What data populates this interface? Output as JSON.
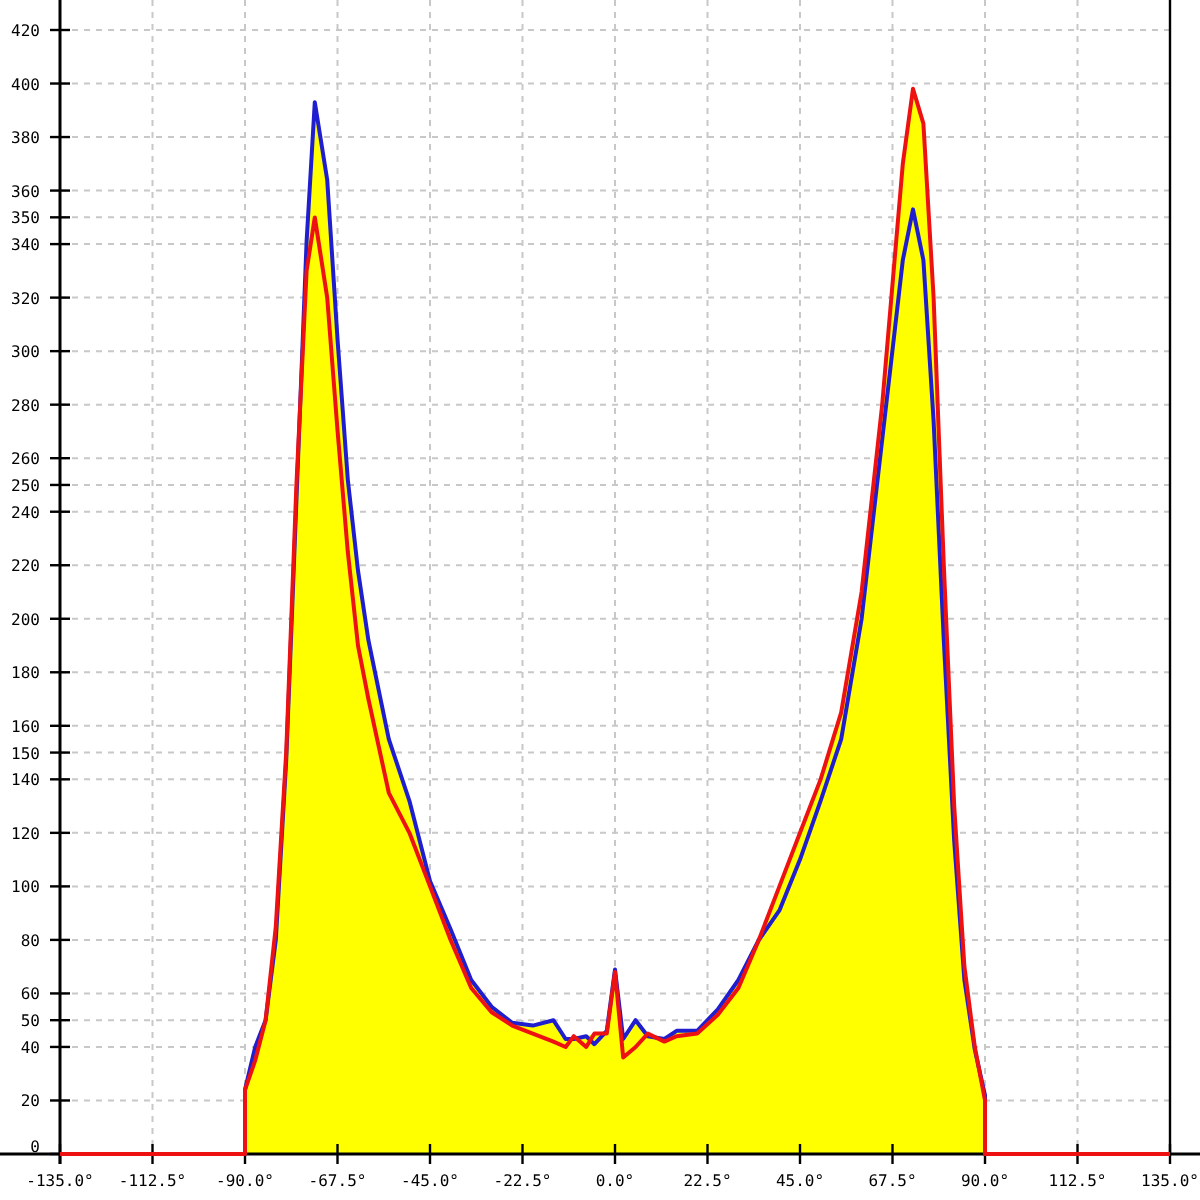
{
  "chart": {
    "chart_data": {
      "type": "line",
      "grid": true,
      "x": [
        -135,
        -90,
        -90,
        -87.5,
        -85,
        -82.5,
        -80,
        -77.5,
        -75,
        -73,
        -70,
        -67.5,
        -65,
        -62.5,
        -60,
        -55,
        -50,
        -45,
        -40,
        -35,
        -30,
        -25,
        -20,
        -15,
        -12,
        -10,
        -7,
        -5,
        -2,
        0,
        2,
        5,
        8,
        12,
        15,
        20,
        25,
        30,
        35,
        40,
        45,
        50,
        55,
        60,
        65,
        70,
        72.5,
        75,
        77.5,
        80,
        82.5,
        85,
        87.5,
        90,
        90,
        135
      ],
      "series": [
        {
          "color": "#1f1fd0",
          "values": [
            0,
            0,
            24,
            40,
            50,
            80,
            147,
            244,
            341,
            393,
            364,
            304,
            252,
            218,
            192,
            155,
            132,
            102,
            84,
            65,
            55,
            49,
            48,
            50,
            43,
            43,
            44,
            41,
            46,
            69,
            43,
            50,
            44,
            43,
            46,
            46,
            54,
            65,
            80,
            91,
            110,
            132,
            155,
            200,
            267,
            334,
            353,
            334,
            274,
            192,
            117,
            65,
            39,
            22,
            0,
            0
          ]
        },
        {
          "color": "#ee1111",
          "values": [
            0,
            0,
            24,
            35,
            50,
            85,
            150,
            250,
            330,
            350,
            320,
            270,
            225,
            190,
            170,
            135,
            120,
            100,
            80,
            62,
            53,
            48,
            45,
            42,
            40,
            44,
            40,
            45,
            45,
            68,
            36,
            40,
            45,
            42,
            44,
            45,
            52,
            62,
            80,
            100,
            120,
            140,
            165,
            210,
            280,
            370,
            398,
            385,
            320,
            220,
            130,
            70,
            40,
            20,
            0,
            0
          ]
        }
      ],
      "xlim": [
        -135,
        135
      ],
      "ylim": [
        0,
        420
      ],
      "xticks": [
        {
          "value": -135,
          "label": "-135.0°"
        },
        {
          "value": -112.5,
          "label": "-112.5°"
        },
        {
          "value": -90,
          "label": "-90.0°"
        },
        {
          "value": -67.5,
          "label": "-67.5°"
        },
        {
          "value": -45,
          "label": "-45.0°"
        },
        {
          "value": -22.5,
          "label": "-22.5°"
        },
        {
          "value": 0,
          "label": "0.0°"
        },
        {
          "value": 22.5,
          "label": "22.5°"
        },
        {
          "value": 45,
          "label": "45.0°"
        },
        {
          "value": 67.5,
          "label": "67.5°"
        },
        {
          "value": 90,
          "label": "90.0°"
        },
        {
          "value": 112.5,
          "label": "112.5°"
        },
        {
          "value": 135,
          "label": "135.0°"
        }
      ],
      "yticks": [
        0,
        20,
        40,
        50,
        60,
        80,
        100,
        120,
        140,
        150,
        160,
        180,
        200,
        220,
        240,
        250,
        260,
        280,
        300,
        320,
        340,
        350,
        360,
        380,
        400,
        420
      ]
    }
  }
}
